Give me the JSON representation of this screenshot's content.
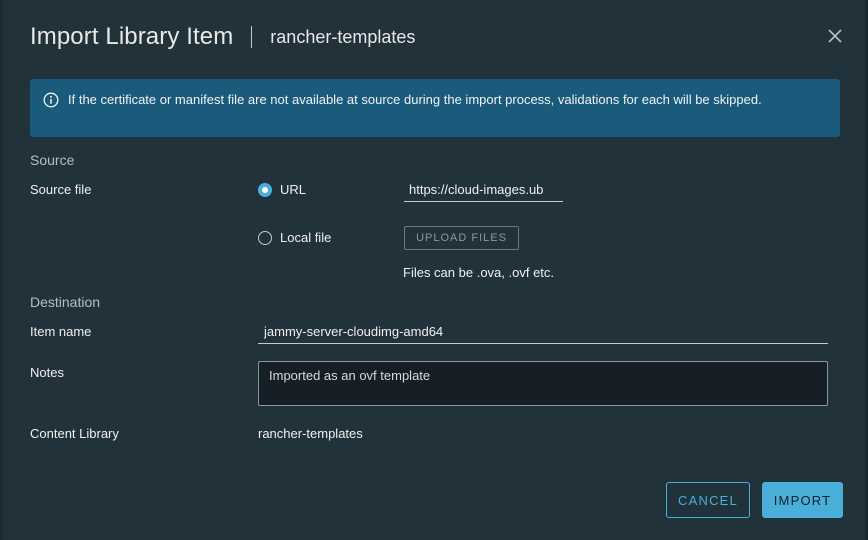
{
  "dialog": {
    "title": "Import Library Item",
    "subtitle": "rancher-templates",
    "close_icon": "close-icon"
  },
  "alert": {
    "icon": "info-icon",
    "message": "If the certificate or manifest file are not available at source during the import process, validations for each will be skipped."
  },
  "source": {
    "section_title": "Source",
    "field_label": "Source file",
    "options": [
      {
        "label": "URL",
        "selected": true
      },
      {
        "label": "Local file",
        "selected": false
      }
    ],
    "url_value": "https://cloud-images.ub",
    "upload_label": "UPLOAD FILES",
    "hint": "Files can be .ova, .ovf etc."
  },
  "destination": {
    "section_title": "Destination",
    "item_name_label": "Item name",
    "item_name_value": "jammy-server-cloudimg-amd64",
    "notes_label": "Notes",
    "notes_value": "Imported as an ovf template",
    "content_library_label": "Content Library",
    "content_library_value": "rancher-templates"
  },
  "footer": {
    "cancel_label": "CANCEL",
    "import_label": "IMPORT"
  },
  "colors": {
    "accent": "#49afd9",
    "alert_bg": "#1a5b7c",
    "dialog_bg": "#22323b"
  }
}
